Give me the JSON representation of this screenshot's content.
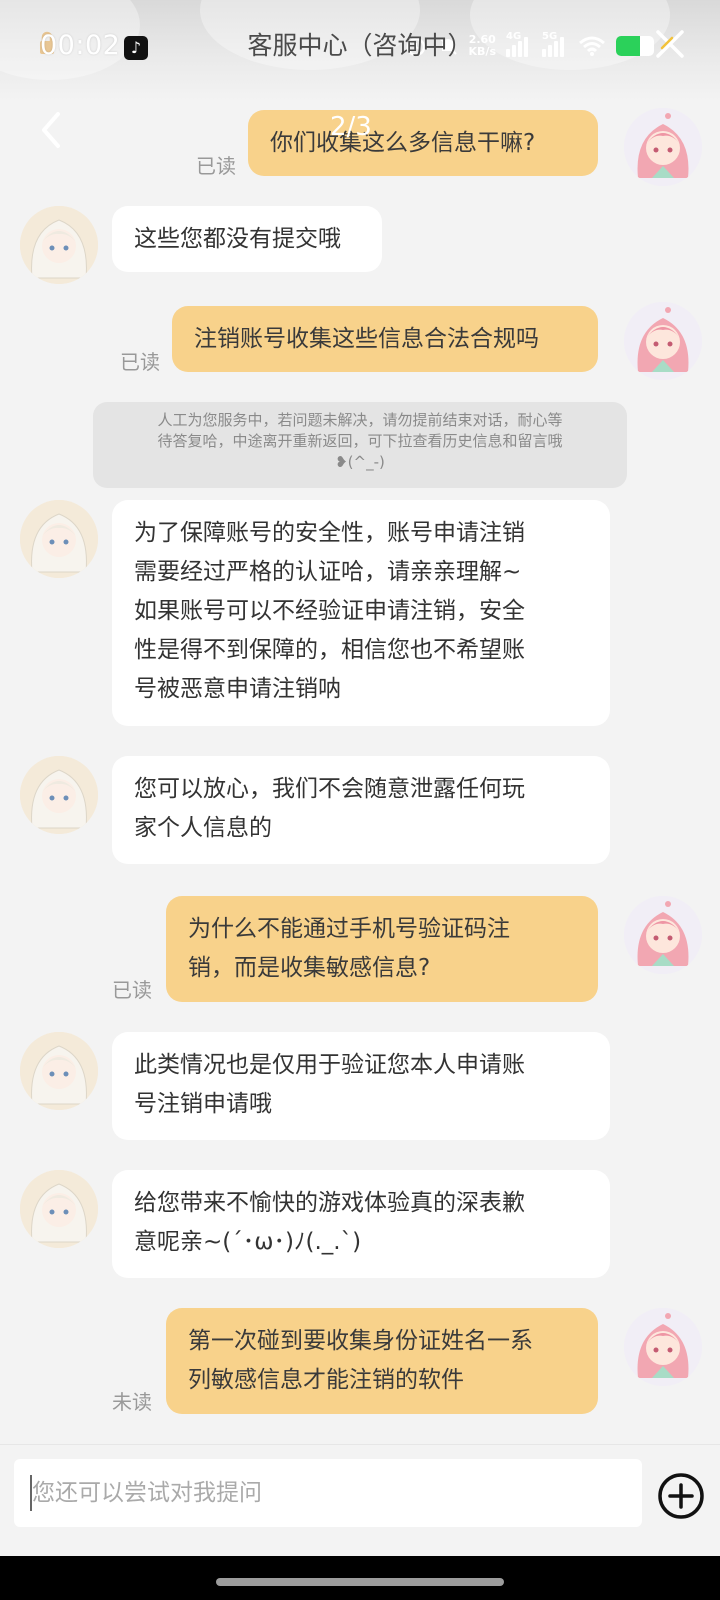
{
  "status_bar": {
    "time": "00:02",
    "net_speed_value": "2.60",
    "net_speed_unit": "KB/s",
    "signal_1_label": "4G",
    "signal_2_label": "5G"
  },
  "header": {
    "title": "客服中心（咨询中）",
    "page_indicator": "2/3"
  },
  "colors": {
    "user_bubble": "#f8d28b",
    "agent_bubble": "#ffffff",
    "background": "#f3f3f3"
  },
  "messages": [
    {
      "from": "user",
      "text": "你们收集这么多信息干嘛?",
      "status": "已读"
    },
    {
      "from": "agent",
      "text": "这些您都没有提交哦"
    },
    {
      "from": "user",
      "text": "注销账号收集这些信息合法合规吗",
      "status": "已读"
    },
    {
      "from": "agent",
      "text": "为了保障账号的安全性，账号申请注销\n需要经过严格的认证哈，请亲亲理解~\n如果账号可以不经验证申请注销，安全\n性是得不到保障的，相信您也不希望账\n号被恶意申请注销呐"
    },
    {
      "from": "agent",
      "text": "您可以放心，我们不会随意泄露任何玩\n家个人信息的"
    },
    {
      "from": "user",
      "text": "为什么不能通过手机号验证码注\n销，而是收集敏感信息?",
      "status": "已读"
    },
    {
      "from": "agent",
      "text": "此类情况也是仅用于验证您本人申请账\n号注销申请哦"
    },
    {
      "from": "agent",
      "text": "给您带来不愉快的游戏体验真的深表歉\n意呢亲~(´･ω･)ﾉ(._.`)"
    },
    {
      "from": "user",
      "text": "第一次碰到要收集身份证姓名一系\n列敏感信息才能注销的软件",
      "status": "未读"
    }
  ],
  "system_notice": "人工为您服务中，若问题未解决，请勿提前结束对话，耐心等\n待答复哈，中途离开重新返回，可下拉查看历史信息和留言哦\n❥(^_-)",
  "input": {
    "placeholder": "您还可以尝试对我提问",
    "value": ""
  },
  "icons": {
    "back": "chevron-left-icon",
    "close": "close-icon",
    "plus": "plus-circle-icon"
  }
}
